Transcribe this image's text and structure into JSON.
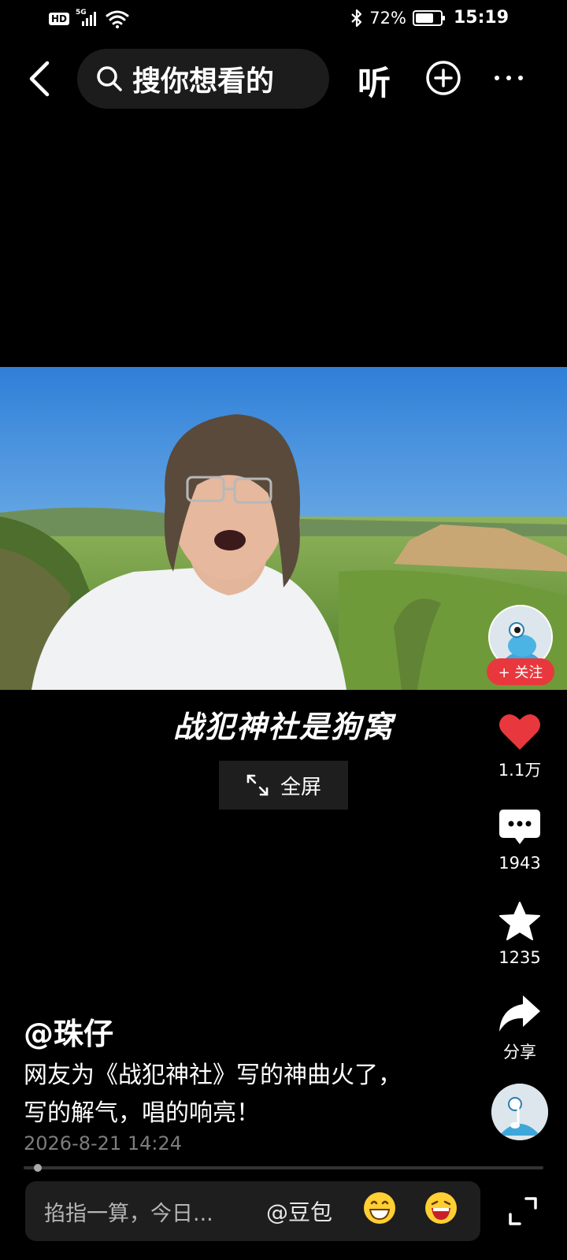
{
  "status_bar": {
    "hd": "HD",
    "network": "5G",
    "battery": "72%",
    "battery_level": 0.72,
    "time": "15:19"
  },
  "top_bar": {
    "search_placeholder": "搜你想看的",
    "listen_label": "听"
  },
  "video": {
    "caption": "战犯神社是狗窝",
    "fullscreen_label": "全屏"
  },
  "side_rail": {
    "follow_label": "+ 关注",
    "like_count": "1.1万",
    "comment_count": "1943",
    "favorite_count": "1235",
    "share_label": "分享"
  },
  "post": {
    "author": "@珠仔",
    "description": "网友为《战犯神社》写的神曲火了，写的解气，唱的响亮！",
    "date": "2026-8-21 14:24",
    "progress": 0.02
  },
  "comment_bar": {
    "placeholder": "掐指一算，今日...",
    "ai_mention": "@豆包"
  },
  "colors": {
    "background": "#000000",
    "like_red": "#e8383d",
    "follow_red": "#e8383d",
    "muted_text": "#7d7d7d"
  }
}
